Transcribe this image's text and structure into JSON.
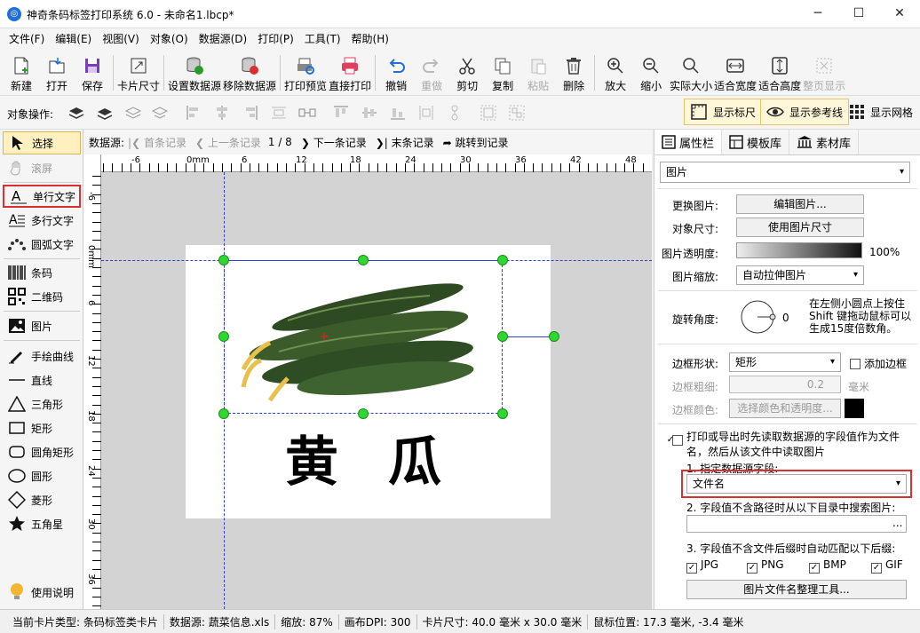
{
  "window": {
    "title": "神奇条码标签打印系统 6.0 - 未命名1.lbcp*",
    "logo": "app-logo",
    "minimize": "─",
    "maximize": "☐",
    "close": "✕"
  },
  "menu": [
    "文件(F)",
    "编辑(E)",
    "视图(V)",
    "对象(O)",
    "数据源(D)",
    "打印(P)",
    "工具(T)",
    "帮助(H)"
  ],
  "toolbar": {
    "new": "新建",
    "open": "打开",
    "save": "保存",
    "card_size": "卡片尺寸",
    "set_datasource": "设置数据源",
    "remove_datasource": "移除数据源",
    "print_preview": "打印预览",
    "direct_print": "直接打印",
    "undo": "撤销",
    "redo": "重做",
    "cut": "剪切",
    "copy": "复制",
    "paste": "粘贴",
    "delete": "删除",
    "zoom_in": "放大",
    "zoom_out": "缩小",
    "actual_size": "实际大小",
    "fit_width": "适合宽度",
    "fit_height": "适合高度",
    "full_page": "整页显示"
  },
  "toolbar2": {
    "object_ops": "对象操作:",
    "show_ruler": "显示标尺",
    "show_guides": "显示参考线",
    "show_grid": "显示网格"
  },
  "leftpanel": {
    "select": "选择",
    "scroll": "滚屏",
    "single_text": "单行文字",
    "multi_text": "多行文字",
    "arc_text": "圆弧文字",
    "barcode": "条码",
    "qrcode": "二维码",
    "image": "图片",
    "freehand": "手绘曲线",
    "line": "直线",
    "triangle": "三角形",
    "rect": "矩形",
    "round_rect": "圆角矩形",
    "circle": "圆形",
    "diamond": "菱形",
    "star": "五角星",
    "help": "使用说明"
  },
  "navbar": {
    "datasource_label": "数据源:",
    "first": "首条记录",
    "prev": "上一条记录",
    "position": "1 / 8",
    "next": "下一条记录",
    "last": "末条记录",
    "jump": "跳转到记录"
  },
  "ruler": {
    "top_labels": [
      "-6",
      "0mm",
      "6",
      "12",
      "18",
      "24",
      "30",
      "36",
      "42",
      "48"
    ],
    "left_labels": [
      "-6",
      "0mm",
      "6",
      "12",
      "18",
      "24",
      "30",
      "36"
    ]
  },
  "card": {
    "text": "黄瓜"
  },
  "rightpanel": {
    "tabs": [
      "属性栏",
      "模板库",
      "素材库"
    ],
    "object_type": "图片",
    "change_image_label": "更换图片:",
    "edit_image_btn": "编辑图片...",
    "object_size_label": "对象尺寸:",
    "use_image_size_btn": "使用图片尺寸",
    "opacity_label": "图片透明度:",
    "opacity_value": "100%",
    "scale_label": "图片缩放:",
    "scale_value": "自动拉伸图片",
    "rotation_label": "旋转角度:",
    "rotation_value": "0",
    "rotation_hint": "在左侧小圆点上按住 Shift 键拖动鼠标可以生成15度倍数角。",
    "border_shape_label": "边框形状:",
    "border_shape_value": "矩形",
    "add_border": "添加边框",
    "border_width_label": "边框粗细:",
    "border_width_value": "0.2",
    "border_width_unit": "毫米",
    "border_color_label": "边框颜色:",
    "border_color_btn": "选择颜色和透明度...",
    "border_color": "#000000",
    "read_from_ds": "打印或导出时先读取数据源的字段值作为文件名，然后从该文件中读取图片",
    "step1": "1. 指定数据源字段:",
    "field_value": "文件名",
    "step2": "2. 字段值不含路径时从以下目录中搜索图片:",
    "browse": "...",
    "step3": "3. 字段值不含文件后缀时自动匹配以下后缀:",
    "ext": [
      "JPG",
      "PNG",
      "BMP",
      "GIF"
    ],
    "tool_btn": "图片文件名整理工具..."
  },
  "status": {
    "card_type": "当前卡片类型: 条码标签类卡片",
    "datasource": "数据源: 蔬菜信息.xls",
    "zoom": "缩放: 87%",
    "dpi": "画布DPI: 300",
    "card_size": "卡片尺寸: 40.0 毫米 x 30.0 毫米",
    "mouse": "鼠标位置: 17.3 毫米, -3.4 毫米"
  },
  "colors": {
    "accent": "#1e6fd9",
    "handle": "#2ed82e",
    "guide": "#3040e0",
    "highlight_border": "#d93030"
  }
}
